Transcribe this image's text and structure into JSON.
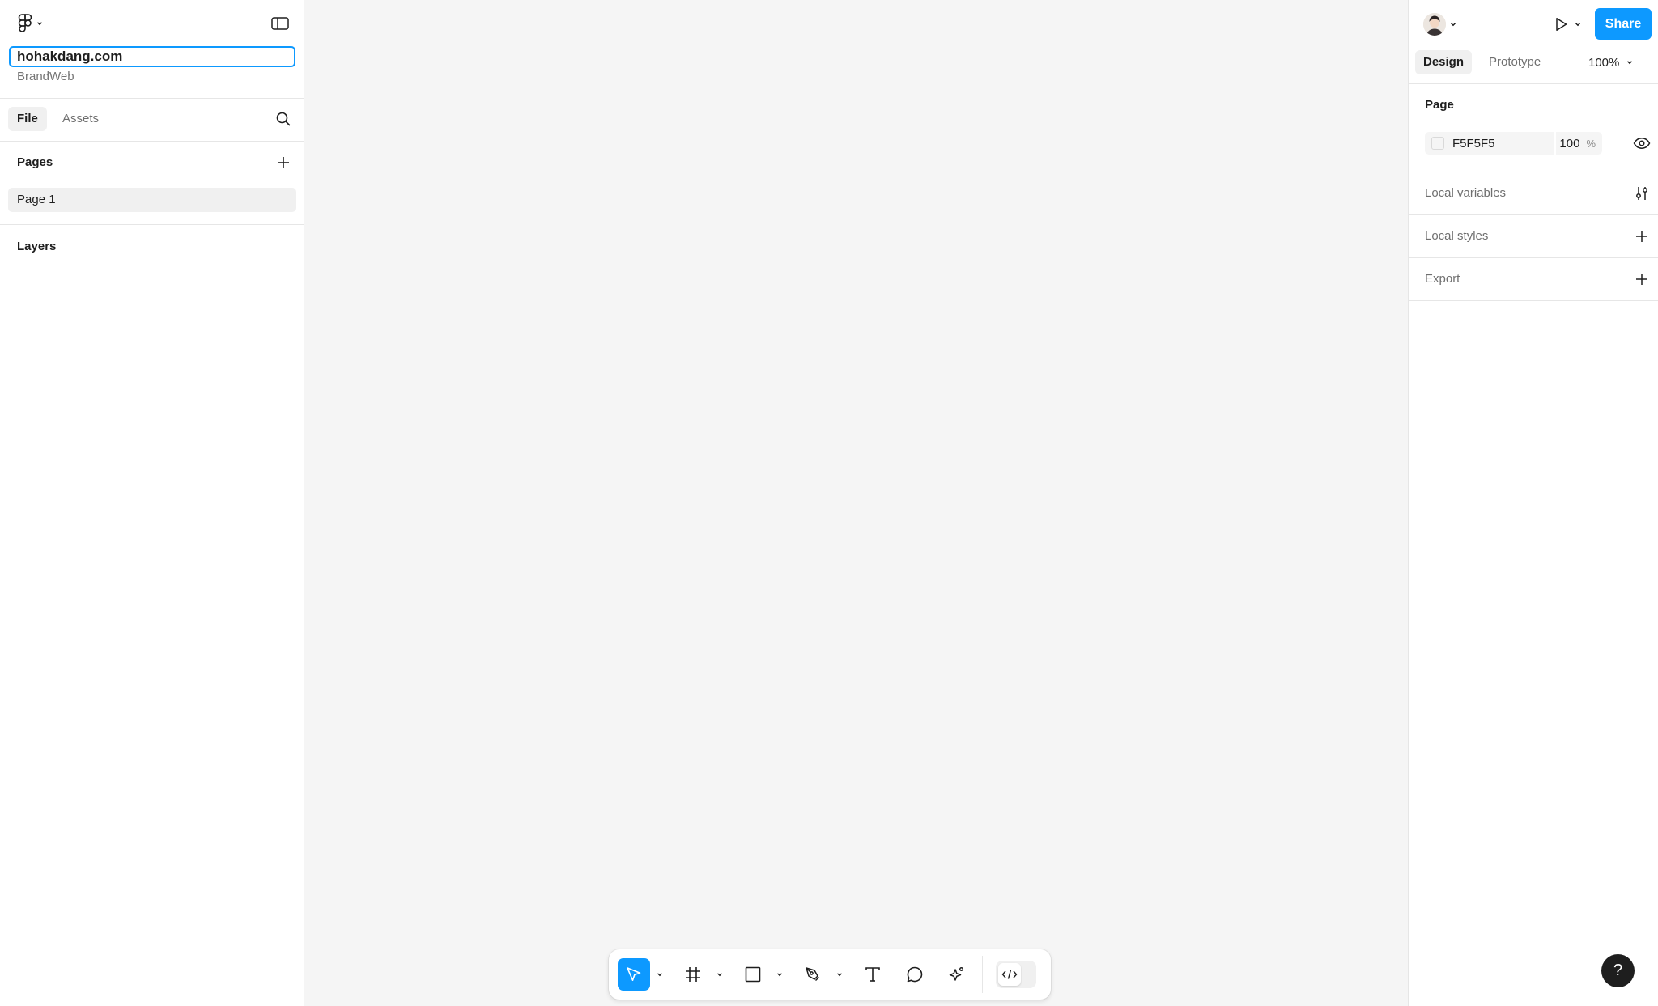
{
  "file": {
    "name": "hohakdang.com",
    "project": "BrandWeb"
  },
  "left_panel": {
    "tabs": [
      {
        "label": "File",
        "active": true
      },
      {
        "label": "Assets",
        "active": false
      }
    ],
    "pages_title": "Pages",
    "pages": [
      {
        "label": "Page 1",
        "selected": true
      }
    ],
    "layers_title": "Layers"
  },
  "header": {
    "share_label": "Share"
  },
  "right_panel": {
    "tabs": [
      {
        "label": "Design",
        "active": true
      },
      {
        "label": "Prototype",
        "active": false
      }
    ],
    "zoom": "100%",
    "page_section": {
      "title": "Page",
      "background_hex": "F5F5F5",
      "background_opacity": "100",
      "opacity_unit": "%"
    },
    "rows": [
      {
        "label": "Local variables",
        "icon": "sliders-icon"
      },
      {
        "label": "Local styles",
        "icon": "plus-icon"
      },
      {
        "label": "Export",
        "icon": "plus-icon"
      }
    ]
  },
  "toolbar": {
    "tools": [
      "move",
      "frame",
      "rectangle",
      "pen",
      "text",
      "comment",
      "actions"
    ],
    "active_tool": "move",
    "dev_mode": false
  },
  "help_label": "?",
  "colors": {
    "accent": "#0d99ff",
    "canvas": "#f5f5f5",
    "panel": "#ffffff",
    "text": "#1e1e1e",
    "muted_text": "#757575",
    "help_button": "#1e1e1e"
  }
}
